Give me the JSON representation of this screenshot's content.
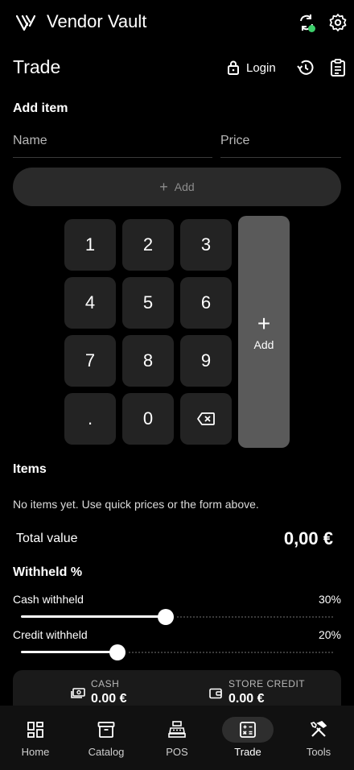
{
  "app": {
    "title": "Vendor Vault",
    "sync_status_color": "#3ccf6b"
  },
  "page": {
    "title": "Trade",
    "login_label": "Login"
  },
  "add_item": {
    "heading": "Add item",
    "name_placeholder": "Name",
    "price_placeholder": "Price",
    "add_label": "Add"
  },
  "keypad": {
    "keys": [
      "1",
      "2",
      "3",
      "4",
      "5",
      "6",
      "7",
      "8",
      "9",
      ".",
      "0"
    ],
    "add_label": "Add"
  },
  "items": {
    "heading": "Items",
    "empty_text": "No items yet. Use quick prices or the form above.",
    "total_label": "Total value",
    "total_value": "0,00 €"
  },
  "withheld": {
    "heading": "Withheld %",
    "cash": {
      "label": "Cash withheld",
      "percent_label": "30%",
      "level": 0.3
    },
    "credit": {
      "label": "Credit withheld",
      "percent_label": "20%",
      "level": 0.2
    }
  },
  "summary": {
    "cash": {
      "label": "CASH",
      "value": "0.00 €"
    },
    "credit": {
      "label": "STORE CREDIT",
      "value": "0.00 €"
    }
  },
  "nav": {
    "items": [
      {
        "label": "Home",
        "icon": "home-grid-icon"
      },
      {
        "label": "Catalog",
        "icon": "catalog-box-icon"
      },
      {
        "label": "POS",
        "icon": "cash-register-icon"
      },
      {
        "label": "Trade",
        "icon": "calculator-icon",
        "active": true
      },
      {
        "label": "Tools",
        "icon": "tools-icon"
      }
    ]
  }
}
